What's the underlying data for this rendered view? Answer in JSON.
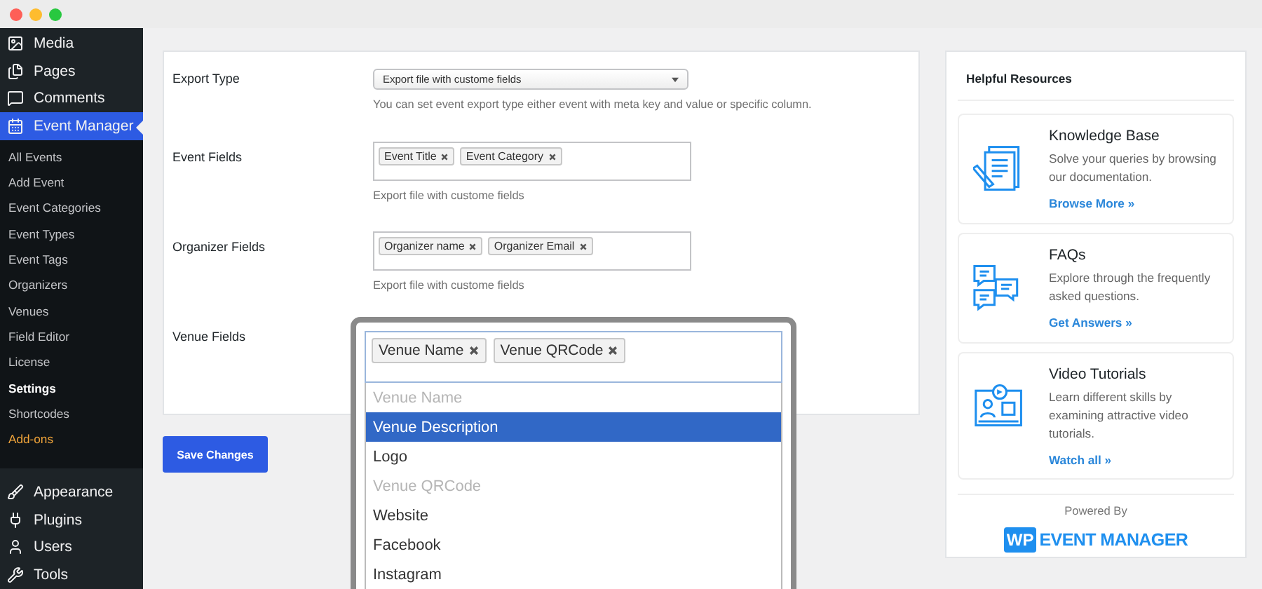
{
  "menu": [
    {
      "label": "Media",
      "selected": false
    },
    {
      "label": "Pages",
      "selected": false
    },
    {
      "label": "Comments",
      "selected": false
    },
    {
      "label": "Event Manager",
      "selected": true
    }
  ],
  "submenu": [
    {
      "label": "All Events",
      "selected": false,
      "kind": "link"
    },
    {
      "label": "Add Event",
      "selected": false,
      "kind": "link"
    },
    {
      "label": "Event Categories",
      "selected": false,
      "kind": "link"
    },
    {
      "label": "Event Types",
      "selected": false,
      "kind": "link"
    },
    {
      "label": "Event Tags",
      "selected": false,
      "kind": "link"
    },
    {
      "label": "Organizers",
      "selected": false,
      "kind": "link"
    },
    {
      "label": "Venues",
      "selected": false,
      "kind": "link"
    },
    {
      "label": "Field Editor",
      "selected": false,
      "kind": "link"
    },
    {
      "label": "License",
      "selected": false,
      "kind": "link"
    },
    {
      "label": "Settings",
      "selected": true,
      "kind": "link"
    },
    {
      "label": "Shortcodes",
      "selected": false,
      "kind": "link"
    },
    {
      "label": "Add-ons",
      "selected": false,
      "kind": "addon"
    }
  ],
  "menu_bottom": [
    {
      "label": "Appearance",
      "selected": false
    },
    {
      "label": "Plugins",
      "selected": false
    },
    {
      "label": "Users",
      "selected": false
    },
    {
      "label": "Tools",
      "selected": false
    }
  ],
  "settings": {
    "export_type": {
      "label": "Export Type",
      "value": "Export file with custome fields",
      "help": "You can set event export type either event with meta key and value or specific column."
    },
    "event_fields": {
      "label": "Event Fields",
      "tags": [
        "Event Title",
        "Event Category"
      ],
      "help": "Export file with custome fields"
    },
    "organizer_fields": {
      "label": "Organizer Fields",
      "tags": [
        "Organizer name",
        "Organizer Email"
      ],
      "help": "Export file with custome fields"
    },
    "venue_fields": {
      "label": "Venue Fields",
      "tags": [
        "Venue Name",
        "Venue QRCode"
      ],
      "options": [
        {
          "label": "Venue Name",
          "selected": false,
          "disabled": true
        },
        {
          "label": "Venue Description",
          "selected": true,
          "disabled": false
        },
        {
          "label": "Logo",
          "selected": false,
          "disabled": false
        },
        {
          "label": "Venue QRCode",
          "selected": false,
          "disabled": true
        },
        {
          "label": "Website",
          "selected": false,
          "disabled": false
        },
        {
          "label": "Facebook",
          "selected": false,
          "disabled": false
        },
        {
          "label": "Instagram",
          "selected": false,
          "disabled": false
        }
      ]
    }
  },
  "save_button": "Save Changes",
  "resources": {
    "title": "Helpful Resources",
    "cards": [
      {
        "title": "Knowledge Base",
        "text": "Solve your queries by browsing our documentation.",
        "link": "Browse More »"
      },
      {
        "title": "FAQs",
        "text": "Explore through the frequently asked questions.",
        "link": "Get Answers »"
      },
      {
        "title": "Video Tutorials",
        "text": "Learn different skills by examining attractive video tutorials.",
        "link": "Watch all »"
      }
    ],
    "powered_by": "Powered By",
    "logo_mark": "WP",
    "logo_text": "EVENT MANAGER"
  }
}
